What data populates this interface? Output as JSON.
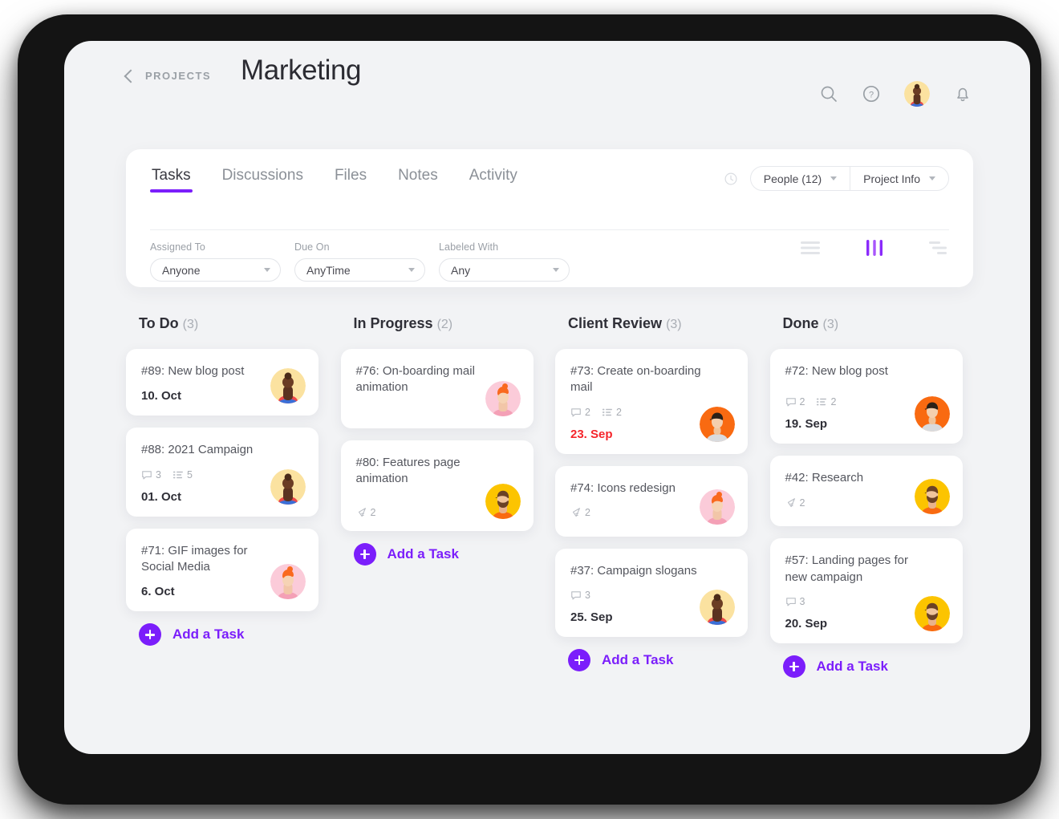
{
  "theme": {
    "accent": "#7b1efb",
    "surface": "#f2f3f5",
    "card": "#ffffff",
    "overdue": "#f5252b",
    "text_primary": "#2f2f37",
    "text_muted": "#9aa0a6",
    "bezel": "#141414"
  },
  "header": {
    "back_label": "PROJECTS",
    "title": "Marketing",
    "icons": [
      "search-icon",
      "help-icon",
      "user-avatar",
      "bell-icon"
    ]
  },
  "tabs": [
    {
      "label": "Tasks",
      "active": true
    },
    {
      "label": "Discussions",
      "active": false
    },
    {
      "label": "Files",
      "active": false
    },
    {
      "label": "Notes",
      "active": false
    },
    {
      "label": "Activity",
      "active": false
    }
  ],
  "pills": [
    {
      "label": "People (12)"
    },
    {
      "label": "Project Info"
    }
  ],
  "filters": [
    {
      "label": "Assigned To",
      "value": "Anyone"
    },
    {
      "label": "Due On",
      "value": "AnyTime"
    },
    {
      "label": "Labeled With",
      "value": "Any"
    }
  ],
  "view_modes": [
    {
      "name": "list-view-icon",
      "active": false
    },
    {
      "name": "board-view-icon",
      "active": true
    },
    {
      "name": "sort-view-icon",
      "active": false
    }
  ],
  "add_task_label": "Add a Task",
  "columns": [
    {
      "title": "To Do",
      "count": "(3)",
      "cards": [
        {
          "title": "#89: New blog post",
          "comments": null,
          "subtasks": null,
          "attachments": null,
          "date": "10. Oct",
          "overdue": false,
          "avatar": "woman-bun-cream"
        },
        {
          "title": "#88: 2021 Campaign",
          "comments": "3",
          "subtasks": "5",
          "attachments": null,
          "date": "01. Oct",
          "overdue": false,
          "avatar": "woman-bun-cream"
        },
        {
          "title": "#71: GIF images for Social Media",
          "comments": null,
          "subtasks": null,
          "attachments": null,
          "date": "6. Oct",
          "overdue": false,
          "avatar": "man-orangehair-pink"
        }
      ]
    },
    {
      "title": "In Progress",
      "count": "(2)",
      "cards": [
        {
          "title": "#76: On-boarding mail animation",
          "comments": null,
          "subtasks": null,
          "attachments": null,
          "date": null,
          "overdue": false,
          "avatar": "man-orangehair-pink"
        },
        {
          "title": "#80: Features page animation",
          "comments": null,
          "subtasks": null,
          "attachments": "2",
          "date": null,
          "overdue": false,
          "avatar": "man-beard-yellow"
        }
      ]
    },
    {
      "title": "Client Review",
      "count": "(3)",
      "cards": [
        {
          "title": "#73: Create on-boarding mail",
          "comments": "2",
          "subtasks": "2",
          "attachments": null,
          "date": "23. Sep",
          "overdue": true,
          "avatar": "man-darkhair-orange"
        },
        {
          "title": "#74: Icons redesign",
          "comments": null,
          "subtasks": null,
          "attachments": "2",
          "date": null,
          "overdue": false,
          "avatar": "man-orangehair-pink"
        },
        {
          "title": "#37: Campaign slogans",
          "comments": "3",
          "subtasks": null,
          "attachments": null,
          "date": "25. Sep",
          "overdue": false,
          "avatar": "woman-bun-cream"
        }
      ]
    },
    {
      "title": "Done",
      "count": "(3)",
      "cards": [
        {
          "title": "#72: New blog post",
          "comments": "2",
          "subtasks": "2",
          "attachments": null,
          "date": "19. Sep",
          "overdue": false,
          "avatar": "man-darkhair-orange"
        },
        {
          "title": "#42: Research",
          "comments": null,
          "subtasks": null,
          "attachments": "2",
          "date": null,
          "overdue": false,
          "avatar": "man-beard-yellow"
        },
        {
          "title": "#57: Landing pages for new campaign",
          "comments": "3",
          "subtasks": null,
          "attachments": null,
          "date": "20. Sep",
          "overdue": false,
          "avatar": "man-beard-yellow"
        }
      ]
    }
  ]
}
